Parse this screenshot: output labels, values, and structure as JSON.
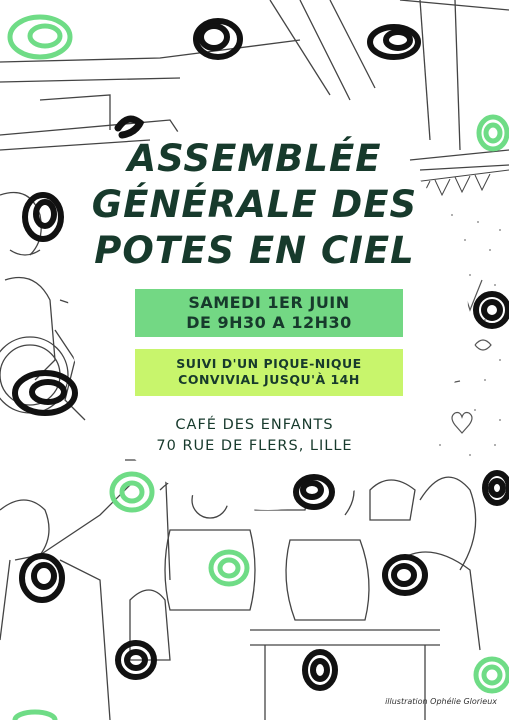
{
  "title": {
    "line1": "ASSEMBLÉE",
    "line2": "GÉNÉRALE DES",
    "line3": "POTES EN CIEL"
  },
  "date_box": {
    "line1": "SAMEDI 1ER JUIN",
    "line2": "DE 9H30 A 12H30"
  },
  "picnic_box": {
    "line1": "SUIVI D'UN PIQUE-NIQUE",
    "line2": "CONVIVIAL JUSQU'À 14H"
  },
  "address": {
    "line1": "CAFÉ DES ENFANTS",
    "line2": "70 RUE DE FLERS, LILLE"
  },
  "credit": "illustration Ophélie Glorieux",
  "colors": {
    "dark_green": "#173a2c",
    "green": "#73d884",
    "lime": "#c8f56c",
    "scribble_dark": "#111111",
    "scribble_green": "#6fdc86"
  }
}
